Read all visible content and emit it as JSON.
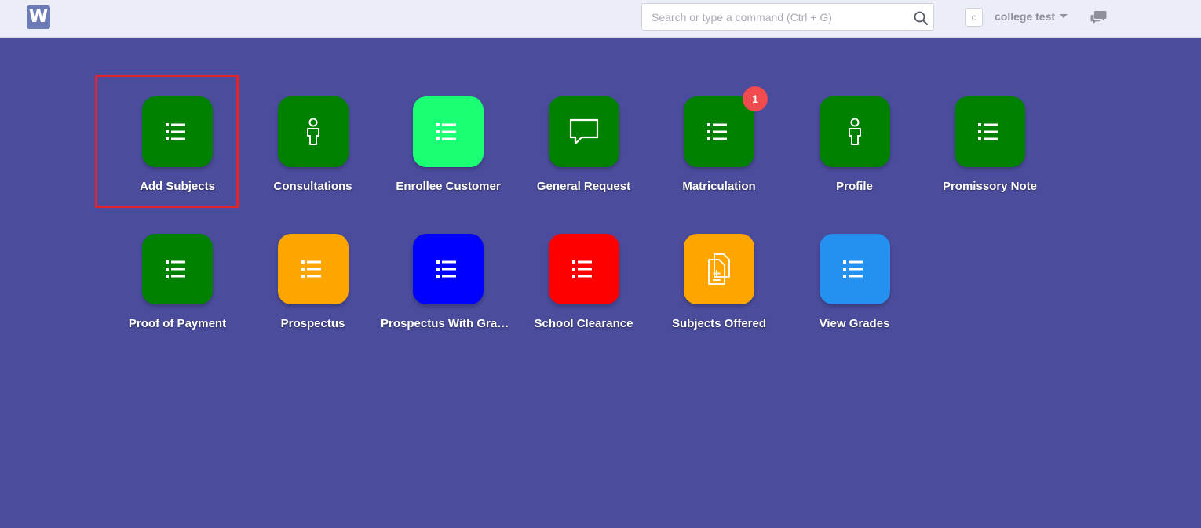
{
  "navbar": {
    "logo_text": "W",
    "search_placeholder": "Search or type a command (Ctrl + G)",
    "avatar_initial": "c",
    "user_name": "college test"
  },
  "modules": [
    {
      "label": "Add Subjects",
      "color": "#008000",
      "icon": "list-icon"
    },
    {
      "label": "Consultations",
      "color": "#008000",
      "icon": "user-icon"
    },
    {
      "label": "Enrollee Customer",
      "color": "#1aff73",
      "icon": "list-icon"
    },
    {
      "label": "General Request",
      "color": "#008000",
      "icon": "comment-icon"
    },
    {
      "label": "Matriculation",
      "color": "#008000",
      "icon": "list-icon",
      "badge": "1"
    },
    {
      "label": "Profile",
      "color": "#008000",
      "icon": "user-icon"
    },
    {
      "label": "Promissory Note",
      "color": "#008000",
      "icon": "list-icon"
    },
    {
      "label": "Proof of Payment",
      "color": "#008000",
      "icon": "list-icon"
    },
    {
      "label": "Prospectus",
      "color": "#ffa500",
      "icon": "list-icon"
    },
    {
      "label": "Prospectus With Grades",
      "color": "#0000ff",
      "icon": "list-icon"
    },
    {
      "label": "School Clearance",
      "color": "#ff0000",
      "icon": "list-icon"
    },
    {
      "label": "Subjects Offered",
      "color": "#ffa500",
      "icon": "document-add-icon"
    },
    {
      "label": "View Grades",
      "color": "#2490ef",
      "icon": "list-icon"
    }
  ],
  "colors": {
    "page_background": "#4b4c9c",
    "highlight": "#e02428",
    "badge": "#f04c50"
  }
}
